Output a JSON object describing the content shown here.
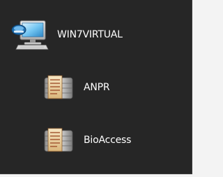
{
  "tree": {
    "root": {
      "label": "WIN7VIRTUAL",
      "icon": "computer-icon"
    },
    "children": [
      {
        "label": "ANPR",
        "icon": "database-server-icon"
      },
      {
        "label": "BioAccess",
        "icon": "database-server-icon"
      }
    ]
  },
  "colors": {
    "panel_background": "#262626",
    "text": "#ffffff",
    "page_background": "#f3f3f3"
  }
}
